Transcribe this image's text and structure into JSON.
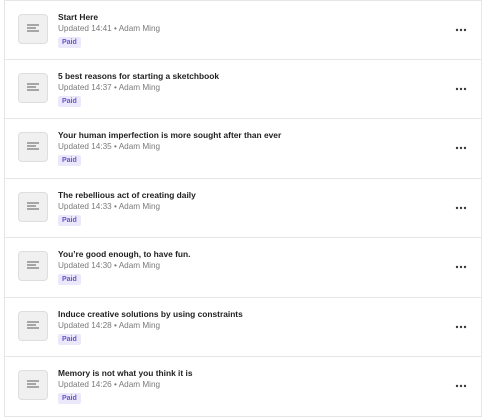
{
  "posts": [
    {
      "title": "Start Here",
      "updated": "Updated 14:41",
      "author": "Adam Ming",
      "badge": "Paid",
      "icon": "document-icon",
      "menu_icon": "more-horizontal-icon"
    },
    {
      "title": "5 best reasons for starting a sketchbook",
      "updated": "Updated 14:37",
      "author": "Adam Ming",
      "badge": "Paid",
      "icon": "document-icon",
      "menu_icon": "more-horizontal-icon"
    },
    {
      "title": "Your human imperfection is more sought after than ever",
      "updated": "Updated 14:35",
      "author": "Adam Ming",
      "badge": "Paid",
      "icon": "document-icon",
      "menu_icon": "more-horizontal-icon"
    },
    {
      "title": "The rebellious act of creating daily",
      "updated": "Updated 14:33",
      "author": "Adam Ming",
      "badge": "Paid",
      "icon": "document-icon",
      "menu_icon": "more-horizontal-icon"
    },
    {
      "title": "You’re good enough, to have fun.",
      "updated": "Updated 14:30",
      "author": "Adam Ming",
      "badge": "Paid",
      "icon": "document-icon",
      "menu_icon": "more-horizontal-icon"
    },
    {
      "title": "Induce creative solutions by using constraints",
      "updated": "Updated 14:28",
      "author": "Adam Ming",
      "badge": "Paid",
      "icon": "document-icon",
      "menu_icon": "more-horizontal-icon"
    },
    {
      "title": "Memory is not what you think it is",
      "updated": "Updated 14:26",
      "author": "Adam Ming",
      "badge": "Paid",
      "icon": "document-icon",
      "menu_icon": "more-horizontal-icon"
    }
  ],
  "separator": " • ",
  "colors": {
    "badge_bg": "#ece8fb",
    "badge_text": "#6a54c9",
    "meta_text": "#7a7a7a",
    "divider": "#e6e6e6"
  }
}
